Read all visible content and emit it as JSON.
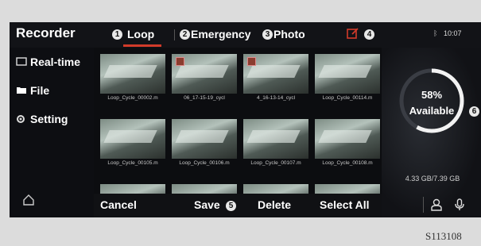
{
  "header": {
    "title": "Recorder",
    "tabs": [
      {
        "label": "Loop",
        "callout": "1"
      },
      {
        "label": "Emergency",
        "callout": "2"
      },
      {
        "label": "Photo",
        "callout": "3"
      }
    ],
    "edit_callout": "4",
    "status_time": "10:07",
    "accent_color": "#d23b2a"
  },
  "sidebar": {
    "items": [
      {
        "label": "Real-time",
        "icon": "screen-icon"
      },
      {
        "label": "File",
        "icon": "folder-icon"
      },
      {
        "label": "Setting",
        "icon": "gear-icon"
      }
    ],
    "home_icon": "home-icon"
  },
  "files": [
    {
      "caption": "Loop_Cycle_00002.m",
      "locked": false
    },
    {
      "caption": "06_17-15-19_cycl",
      "locked": true
    },
    {
      "caption": "4_16-13-14_cycl",
      "locked": true
    },
    {
      "caption": "Loop_Cycle_00114.m",
      "locked": false
    },
    {
      "caption": "Loop_Cycle_00105.m",
      "locked": false
    },
    {
      "caption": "Loop_Cycle_00106.m",
      "locked": false
    },
    {
      "caption": "Loop_Cycle_00107.m",
      "locked": false
    },
    {
      "caption": "Loop_Cycle_00108.m",
      "locked": false
    }
  ],
  "actions": {
    "cancel": "Cancel",
    "save": "Save",
    "save_callout": "5",
    "delete": "Delete",
    "select_all": "Select All"
  },
  "storage": {
    "percent_label": "58%",
    "available_label": "Available",
    "available_fraction": 0.58,
    "callout": "6",
    "size": "4.33 GB/7.39 GB"
  },
  "figure_code": "S113108"
}
